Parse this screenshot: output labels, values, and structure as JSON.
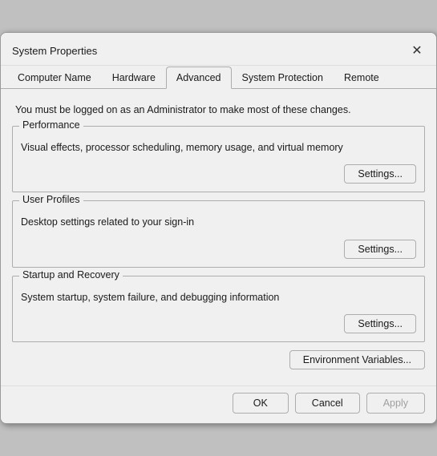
{
  "window": {
    "title": "System Properties",
    "close_label": "✕"
  },
  "tabs": [
    {
      "id": "computer-name",
      "label": "Computer Name",
      "active": false
    },
    {
      "id": "hardware",
      "label": "Hardware",
      "active": false
    },
    {
      "id": "advanced",
      "label": "Advanced",
      "active": true
    },
    {
      "id": "system-protection",
      "label": "System Protection",
      "active": false
    },
    {
      "id": "remote",
      "label": "Remote",
      "active": false
    }
  ],
  "admin_notice": "You must be logged on as an Administrator to make most of these changes.",
  "sections": {
    "performance": {
      "title": "Performance",
      "description": "Visual effects, processor scheduling, memory usage, and virtual memory",
      "button": "Settings..."
    },
    "user_profiles": {
      "title": "User Profiles",
      "description": "Desktop settings related to your sign-in",
      "button": "Settings..."
    },
    "startup_recovery": {
      "title": "Startup and Recovery",
      "description": "System startup, system failure, and debugging information",
      "button": "Settings..."
    }
  },
  "env_button": "Environment Variables...",
  "footer": {
    "ok": "OK",
    "cancel": "Cancel",
    "apply": "Apply"
  }
}
